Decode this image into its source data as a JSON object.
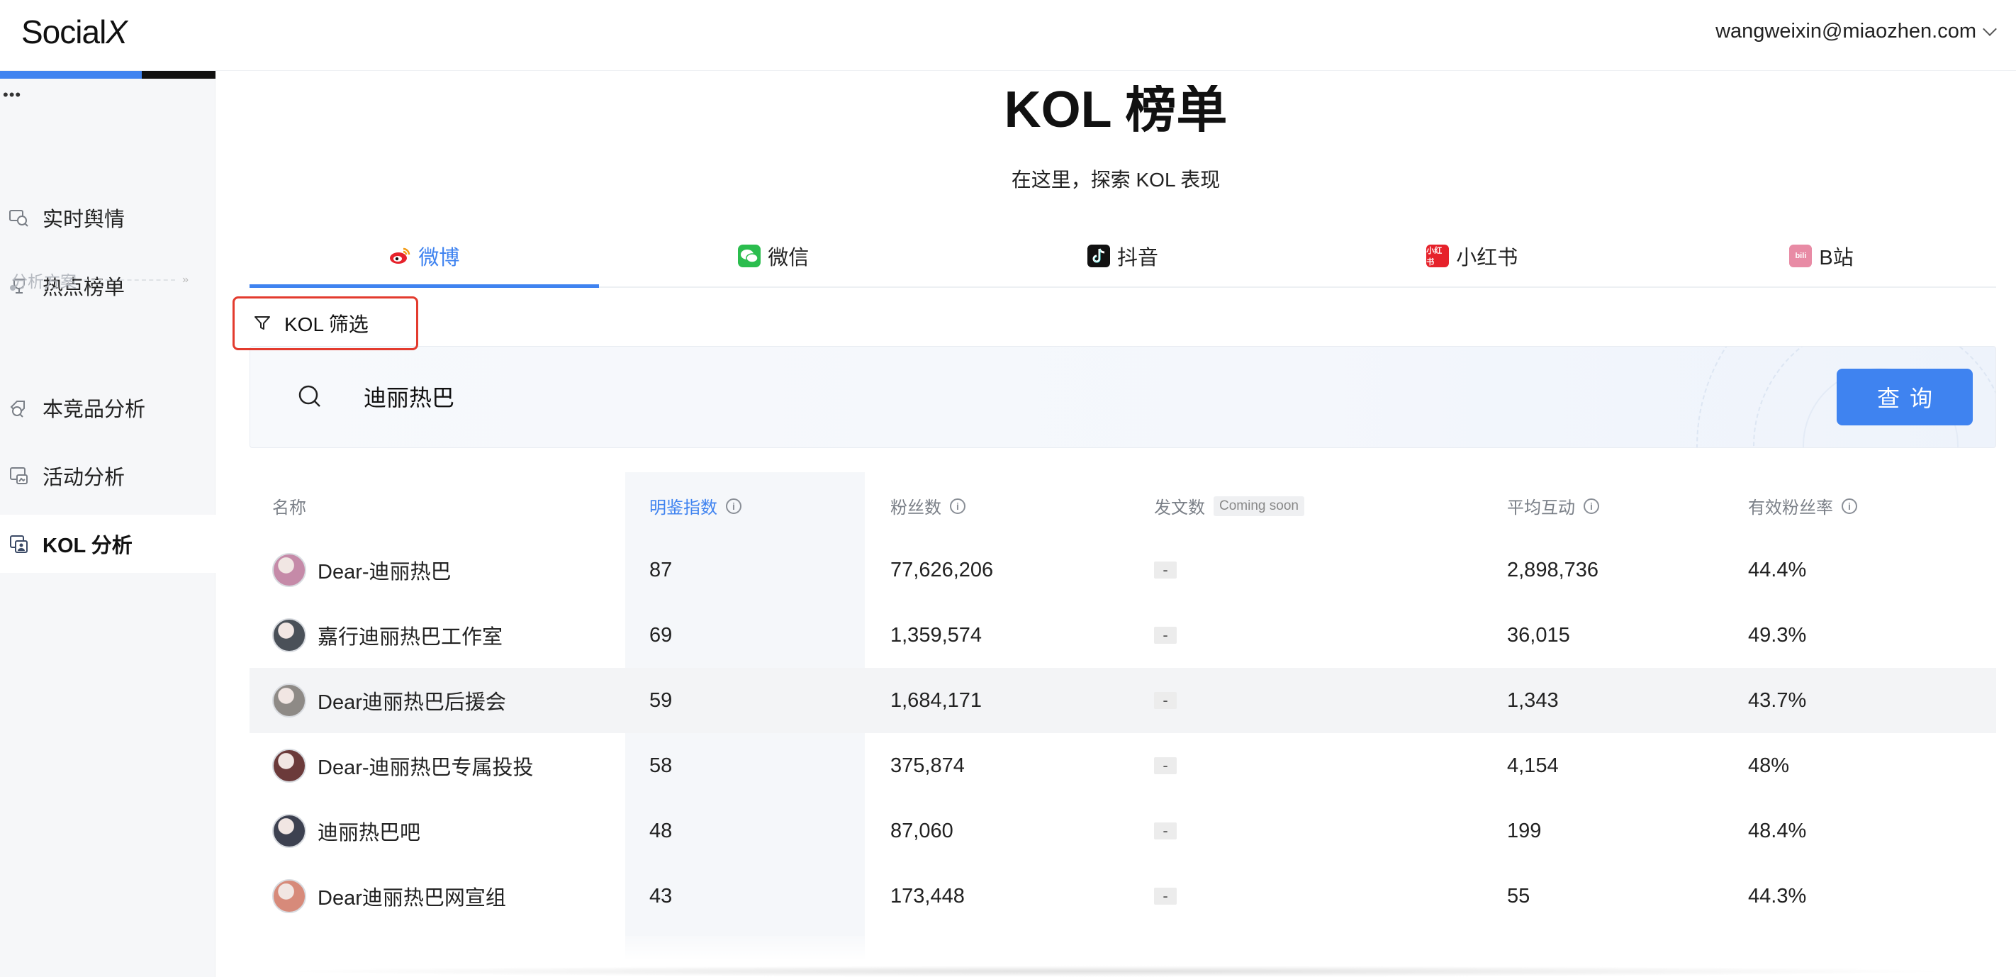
{
  "header": {
    "logo": "Social",
    "logo_x": "X",
    "user_email": "wangweixin@miaozhen.com"
  },
  "sidebar": {
    "dots": "•••",
    "items": [
      {
        "label": "实时舆情",
        "icon": "sentiment-monitor-icon"
      },
      {
        "label": "热点榜单",
        "icon": "trophy-icon"
      },
      {
        "label": "本竞品分析",
        "icon": "compare-icon"
      },
      {
        "label": "活动分析",
        "icon": "campaign-icon"
      },
      {
        "label": "KOL 分析",
        "icon": "kol-icon",
        "active": true
      }
    ],
    "section_label": "分析方案",
    "section_chevron": "»"
  },
  "main": {
    "title": "KOL 榜单",
    "subtitle": "在这里，探索 KOL 表现",
    "tabs": [
      {
        "label": "微博",
        "icon": "weibo-icon",
        "active": true
      },
      {
        "label": "微信",
        "icon": "wechat-icon"
      },
      {
        "label": "抖音",
        "icon": "douyin-icon"
      },
      {
        "label": "小红书",
        "icon": "xiaohongshu-icon",
        "icon_text": "小红书"
      },
      {
        "label": "B站",
        "icon": "bilibili-icon",
        "icon_text": "bili"
      }
    ],
    "filter_label": "KOL 筛选",
    "search": {
      "value": "迪丽热巴",
      "button": "查询"
    }
  },
  "table": {
    "headers": {
      "name": "名称",
      "index": "明鉴指数",
      "fans": "粉丝数",
      "posts": "发文数",
      "posts_badge": "Coming soon",
      "interaction": "平均互动",
      "effective": "有效粉丝率"
    },
    "rows": [
      {
        "name": "Dear-迪丽热巴",
        "index": "87",
        "fans": "77,626,206",
        "posts": "-",
        "interaction": "2,898,736",
        "effective": "44.4%",
        "avatar_color": "#c58aa8"
      },
      {
        "name": "嘉行迪丽热巴工作室",
        "index": "69",
        "fans": "1,359,574",
        "posts": "-",
        "interaction": "36,015",
        "effective": "49.3%",
        "avatar_color": "#4a5058"
      },
      {
        "name": "Dear迪丽热巴后援会",
        "index": "59",
        "fans": "1,684,171",
        "posts": "-",
        "interaction": "1,343",
        "effective": "43.7%",
        "avatar_color": "#8e8a86"
      },
      {
        "name": "Dear-迪丽热巴专属投投",
        "index": "58",
        "fans": "375,874",
        "posts": "-",
        "interaction": "4,154",
        "effective": "48%",
        "avatar_color": "#6b3a3a"
      },
      {
        "name": "迪丽热巴吧",
        "index": "48",
        "fans": "87,060",
        "posts": "-",
        "interaction": "199",
        "effective": "48.4%",
        "avatar_color": "#3d4150"
      },
      {
        "name": "Dear迪丽热巴网宣组",
        "index": "43",
        "fans": "173,448",
        "posts": "-",
        "interaction": "55",
        "effective": "44.3%",
        "avatar_color": "#d78a7a"
      }
    ]
  }
}
